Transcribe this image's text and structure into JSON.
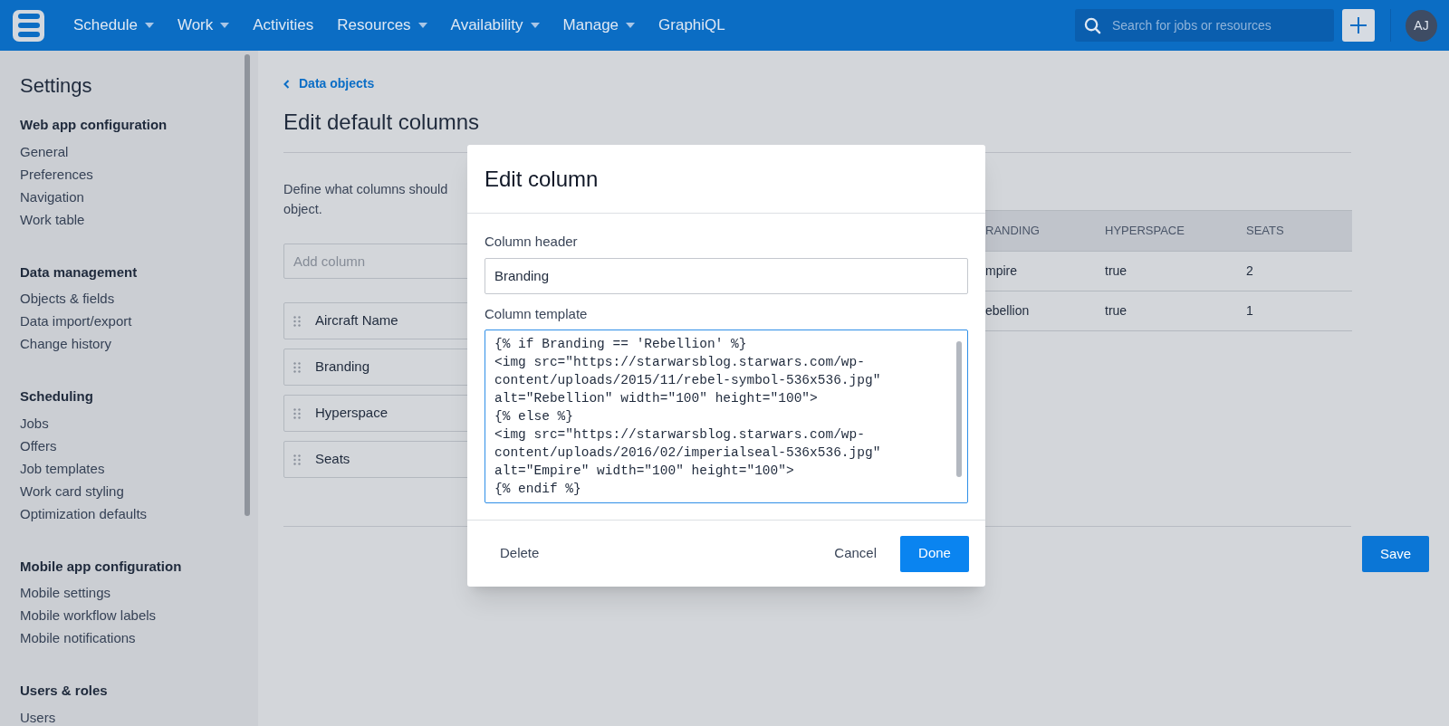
{
  "topbar": {
    "nav": [
      {
        "label": "Schedule",
        "dropdown": true
      },
      {
        "label": "Work",
        "dropdown": true
      },
      {
        "label": "Activities",
        "dropdown": false
      },
      {
        "label": "Resources",
        "dropdown": true
      },
      {
        "label": "Availability",
        "dropdown": true
      },
      {
        "label": "Manage",
        "dropdown": true
      },
      {
        "label": "GraphiQL",
        "dropdown": false
      }
    ],
    "search": {
      "placeholder": "Search for jobs or resources"
    },
    "avatar": "AJ"
  },
  "sidebar": {
    "title": "Settings",
    "sections": [
      {
        "heading": "Web app configuration",
        "items": [
          "General",
          "Preferences",
          "Navigation",
          "Work table"
        ]
      },
      {
        "heading": "Data management",
        "items": [
          "Objects & fields",
          "Data import/export",
          "Change history"
        ]
      },
      {
        "heading": "Scheduling",
        "items": [
          "Jobs",
          "Offers",
          "Job templates",
          "Work card styling",
          "Optimization defaults"
        ]
      },
      {
        "heading": "Mobile app configuration",
        "items": [
          "Mobile settings",
          "Mobile workflow labels",
          "Mobile notifications"
        ]
      },
      {
        "heading": "Users & roles",
        "items": [
          "Users"
        ]
      }
    ]
  },
  "page": {
    "back_link": "Data objects",
    "title": "Edit default columns",
    "intro_lines": [
      "Define what columns should",
      "object."
    ],
    "add_column": {
      "placeholder": "Add column"
    },
    "columns": [
      "Aircraft Name",
      "Branding",
      "Hyperspace",
      "Seats"
    ],
    "table": {
      "columns": [
        "RANDING",
        "HYPERSPACE",
        "SEATS"
      ],
      "rows": [
        [
          "mpire",
          "true",
          "2"
        ],
        [
          "ebellion",
          "true",
          "1"
        ]
      ]
    },
    "save": "Save"
  },
  "dialog": {
    "title": "Edit column",
    "header_label": "Column header",
    "header_value": "Branding",
    "template_label": "Column template",
    "template_value": "{% if Branding == 'Rebellion' %}\n<img src=\"https://starwarsblog.starwars.com/wp-\ncontent/uploads/2015/11/rebel-symbol-536x536.jpg\"\nalt=\"Rebellion\" width=\"100\" height=\"100\">\n{% else %}\n<img src=\"https://starwarsblog.starwars.com/wp-\ncontent/uploads/2016/02/imperialseal-536x536.jpg\"\nalt=\"Empire\" width=\"100\" height=\"100\">\n{% endif %}",
    "buttons": [
      {
        "label": "Delete",
        "kind": "plain"
      },
      {
        "label": "Cancel",
        "kind": "plain"
      },
      {
        "label": "Done",
        "kind": "primary"
      }
    ]
  }
}
